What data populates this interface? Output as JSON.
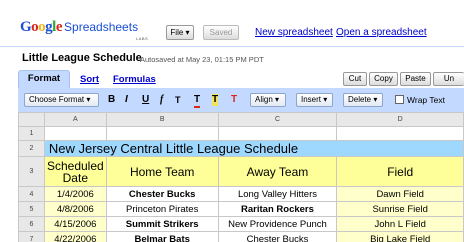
{
  "header": {
    "logo_text": "Google",
    "product": "Spreadsheets",
    "labs": "LABS",
    "file_button": "File ▾",
    "saved_button": "Saved",
    "links": [
      "New spreadsheet",
      "Open a spreadsheet"
    ]
  },
  "doc": {
    "title": "Little League Schedule",
    "autosave": "Autosaved at May 23, 01:15 PM PDT"
  },
  "tabs": [
    {
      "label": "Format",
      "active": true
    },
    {
      "label": "Sort",
      "active": false
    },
    {
      "label": "Formulas",
      "active": false
    }
  ],
  "clipboard": [
    "Cut",
    "Copy",
    "Paste",
    "Un"
  ],
  "toolbar": {
    "choose_format": "Choose Format ▾",
    "bold": "B",
    "italic": "I",
    "underline": "U",
    "font_size": "f",
    "text_size": "T",
    "text_color": "T",
    "bg_color": "T",
    "clear": "T",
    "align": "Align ▾",
    "insert": "Insert ▾",
    "delete": "Delete ▾",
    "wrap_text": "Wrap Text"
  },
  "grid": {
    "columns": [
      "A",
      "B",
      "C",
      "D"
    ],
    "rows": [
      {
        "num": "1",
        "cells": []
      },
      {
        "num": "2",
        "title": "New Jersey Central Little League Schedule"
      },
      {
        "num": "3",
        "headers": [
          "Scheduled Date",
          "Home Team",
          "Away Team",
          "Field"
        ]
      },
      {
        "num": "4",
        "cells": [
          "1/4/2006",
          "Chester Bucks",
          "Long Valley Hitters",
          "Dawn Field"
        ],
        "bold": 1
      },
      {
        "num": "5",
        "cells": [
          "4/8/2006",
          "Princeton Pirates",
          "Raritan Rockers",
          "Sunrise Field"
        ],
        "bold": 2
      },
      {
        "num": "6",
        "cells": [
          "4/15/2006",
          "Summit Strikers",
          "New Providence Punch",
          "John L Field"
        ],
        "bold": 1
      },
      {
        "num": "7",
        "cells": [
          "4/22/2006",
          "Belmar Bats",
          "Chester Bucks",
          "Big Lake Field"
        ],
        "bold": 1
      }
    ]
  },
  "colors": {
    "toolbar_blue": "#c3d9ff",
    "title_row": "#9fd8ff",
    "header_row": "#ffff99",
    "link": "#0000cc"
  }
}
